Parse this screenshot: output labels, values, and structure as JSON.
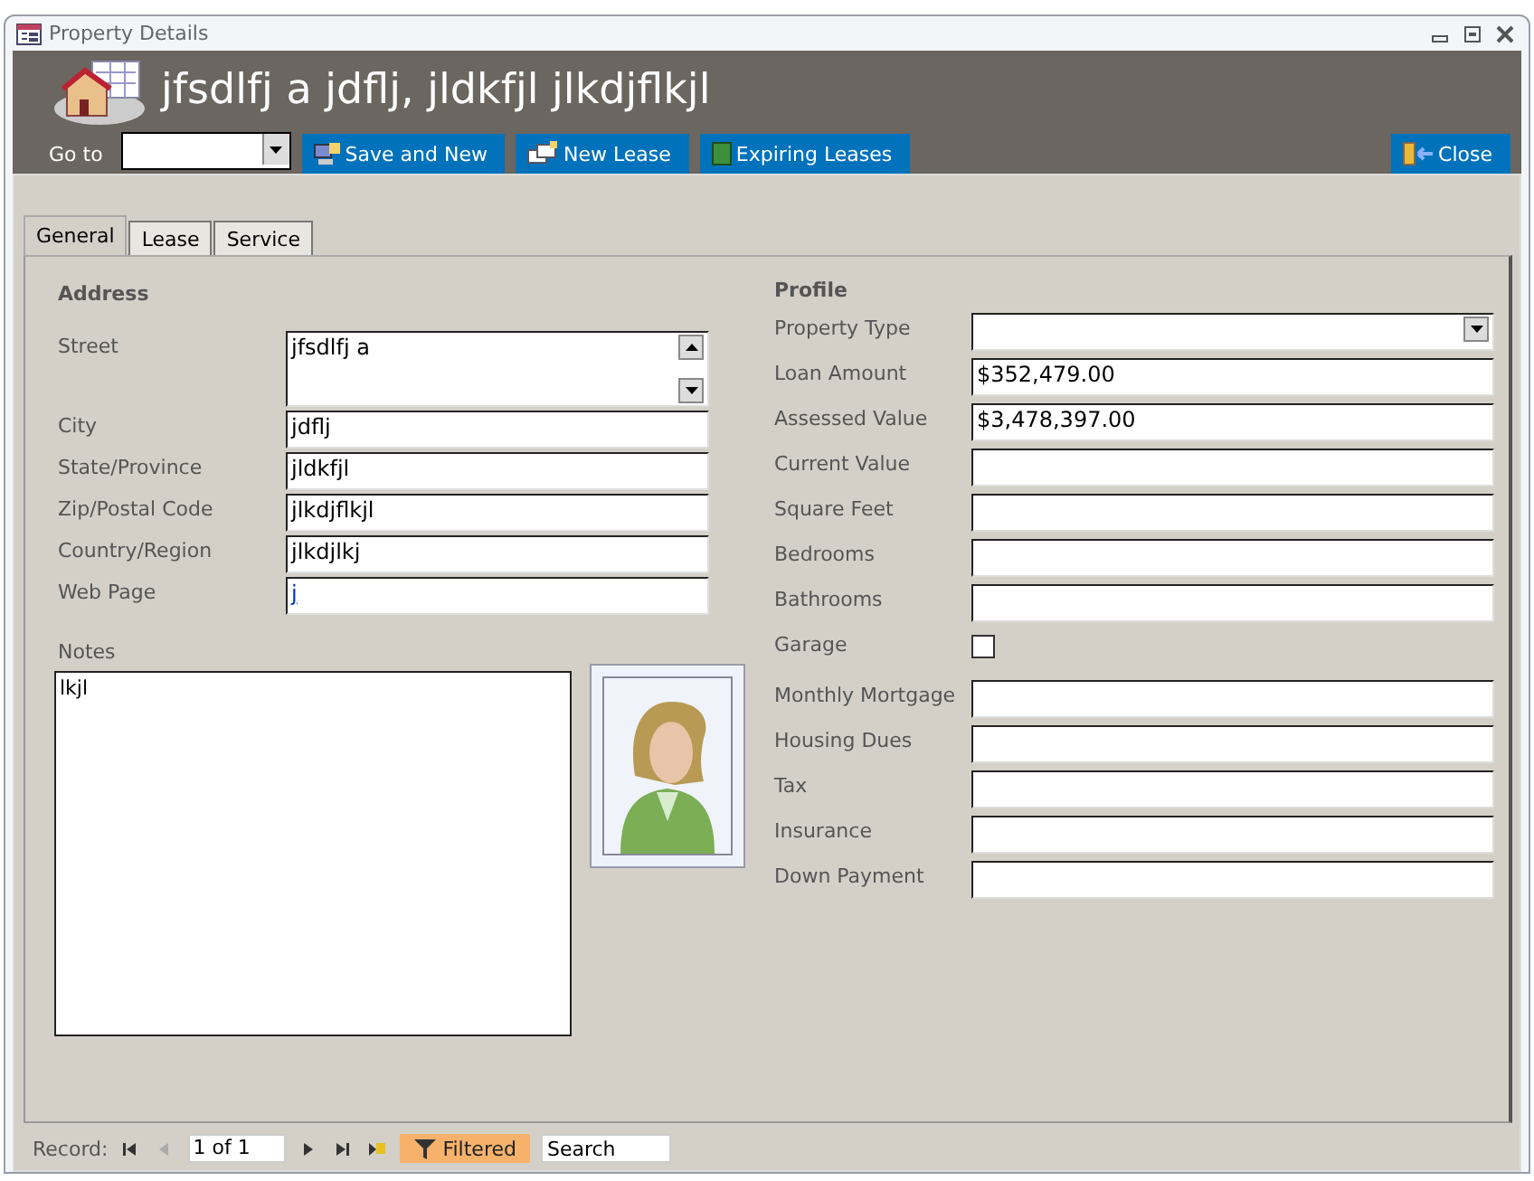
{
  "window": {
    "title": "Property Details"
  },
  "header": {
    "title": "jfsdlfj a jdflj, jldkfjl jlkdjflkjl",
    "goto_label": "Go to",
    "buttons": [
      {
        "label": "Save and New",
        "kind": "save"
      },
      {
        "label": "New Lease",
        "kind": "lease"
      },
      {
        "label": "Expiring Leases",
        "kind": "book"
      }
    ],
    "close_button": {
      "label": "Close"
    }
  },
  "tabs": [
    {
      "label": "General",
      "selected": true
    },
    {
      "label": "Lease",
      "selected": false
    },
    {
      "label": "Service",
      "selected": false
    }
  ],
  "address": {
    "heading": "Address",
    "fields": [
      {
        "label": "Street",
        "kind": "memo",
        "value": "jfsdlfj a"
      },
      {
        "label": "City",
        "kind": "text",
        "value": "jdflj"
      },
      {
        "label": "State/Province",
        "kind": "text",
        "value": "jldkfjl"
      },
      {
        "label": "Zip/Postal Code",
        "kind": "text",
        "value": "jlkdjflkjl"
      },
      {
        "label": "Country/Region",
        "kind": "text",
        "value": "jlkdjlkj"
      },
      {
        "label": "Web Page",
        "kind": "link",
        "value": "j"
      }
    ]
  },
  "notes": {
    "label": "Notes",
    "value": "lkjl"
  },
  "profile": {
    "heading": "Profile",
    "fields": [
      {
        "label": "Property Type",
        "kind": "combo"
      },
      {
        "label": "Loan Amount",
        "kind": "text",
        "value": "$352,479.00"
      },
      {
        "label": "Assessed Value",
        "kind": "text",
        "value": "$3,478,397.00"
      },
      {
        "label": "Current Value",
        "kind": "text"
      },
      {
        "label": "Square Feet",
        "kind": "text"
      },
      {
        "label": "Bedrooms",
        "kind": "text"
      },
      {
        "label": "Bathrooms",
        "kind": "text"
      },
      {
        "label": "Garage",
        "kind": "checkbox",
        "checked": false
      },
      {
        "label": "Monthly Mortgage",
        "kind": "text"
      },
      {
        "label": "Housing Dues",
        "kind": "text"
      },
      {
        "label": "Tax",
        "kind": "text"
      },
      {
        "label": "Insurance",
        "kind": "text"
      },
      {
        "label": "Down Payment",
        "kind": "text"
      }
    ]
  },
  "record_nav": {
    "label": "Record:",
    "position": "1 of 1",
    "buttons": [
      {
        "kind": "first",
        "disabled": false
      },
      {
        "kind": "prev",
        "disabled": true
      },
      {
        "kind": "next",
        "disabled": false
      },
      {
        "kind": "last",
        "disabled": false
      },
      {
        "kind": "new",
        "disabled": false
      }
    ],
    "filter": {
      "label": "Filtered",
      "on": true
    },
    "search_placeholder": "Search"
  }
}
